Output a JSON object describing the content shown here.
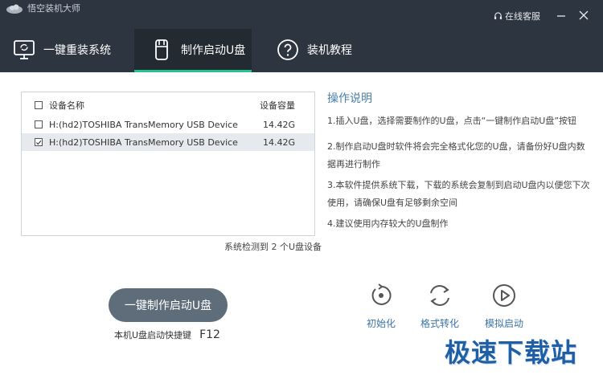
{
  "app": {
    "title": "悟空装机大师",
    "service_label": "在线客服"
  },
  "tabs": [
    {
      "label": "一键重装系统",
      "icon": "monitor-refresh-icon"
    },
    {
      "label": "制作启动U盘",
      "icon": "usb-drive-icon",
      "active": true
    },
    {
      "label": "装机教程",
      "icon": "question-circle-icon"
    }
  ],
  "device_table": {
    "headers": {
      "name": "设备名称",
      "capacity": "设备容量"
    },
    "rows": [
      {
        "name": "H:(hd2)TOSHIBA TransMemory USB Device",
        "capacity": "14.42G",
        "checked": false
      },
      {
        "name": "H:(hd2)TOSHIBA TransMemory USB Device",
        "capacity": "14.42G",
        "checked": true
      }
    ],
    "detect_text": "系统检测到 2 个U盘设备"
  },
  "instructions": {
    "title": "操作说明",
    "items": [
      "1.插入U盘，选择需要制作的U盘，点击“一键制作启动U盘”按钮",
      "2.制作启动U盘时软件将会完全格式化您的U盘，请备份好U盘内数据再进行制作",
      "3.本软件提供系统下载，下载的系统会复制到启动U盘内以便您下次使用，请确保U盘有足够剩余空间",
      "4.建议使用内存较大的U盘制作"
    ]
  },
  "actions": {
    "make_button": "一键制作启动U盘",
    "hotkey_label": "本机U盘启动快捷键",
    "hotkey_value": "F12"
  },
  "tools": [
    {
      "label": "初始化",
      "icon": "refresh-dot-icon"
    },
    {
      "label": "格式转化",
      "icon": "convert-arrows-icon"
    },
    {
      "label": "模拟启动",
      "icon": "play-circle-icon"
    }
  ],
  "watermark": "极速下载站",
  "colors": {
    "titlebar": "#2d3540",
    "accent_green": "#23c28e",
    "button": "#5f6d7b",
    "link_blue": "#3a74a7"
  }
}
